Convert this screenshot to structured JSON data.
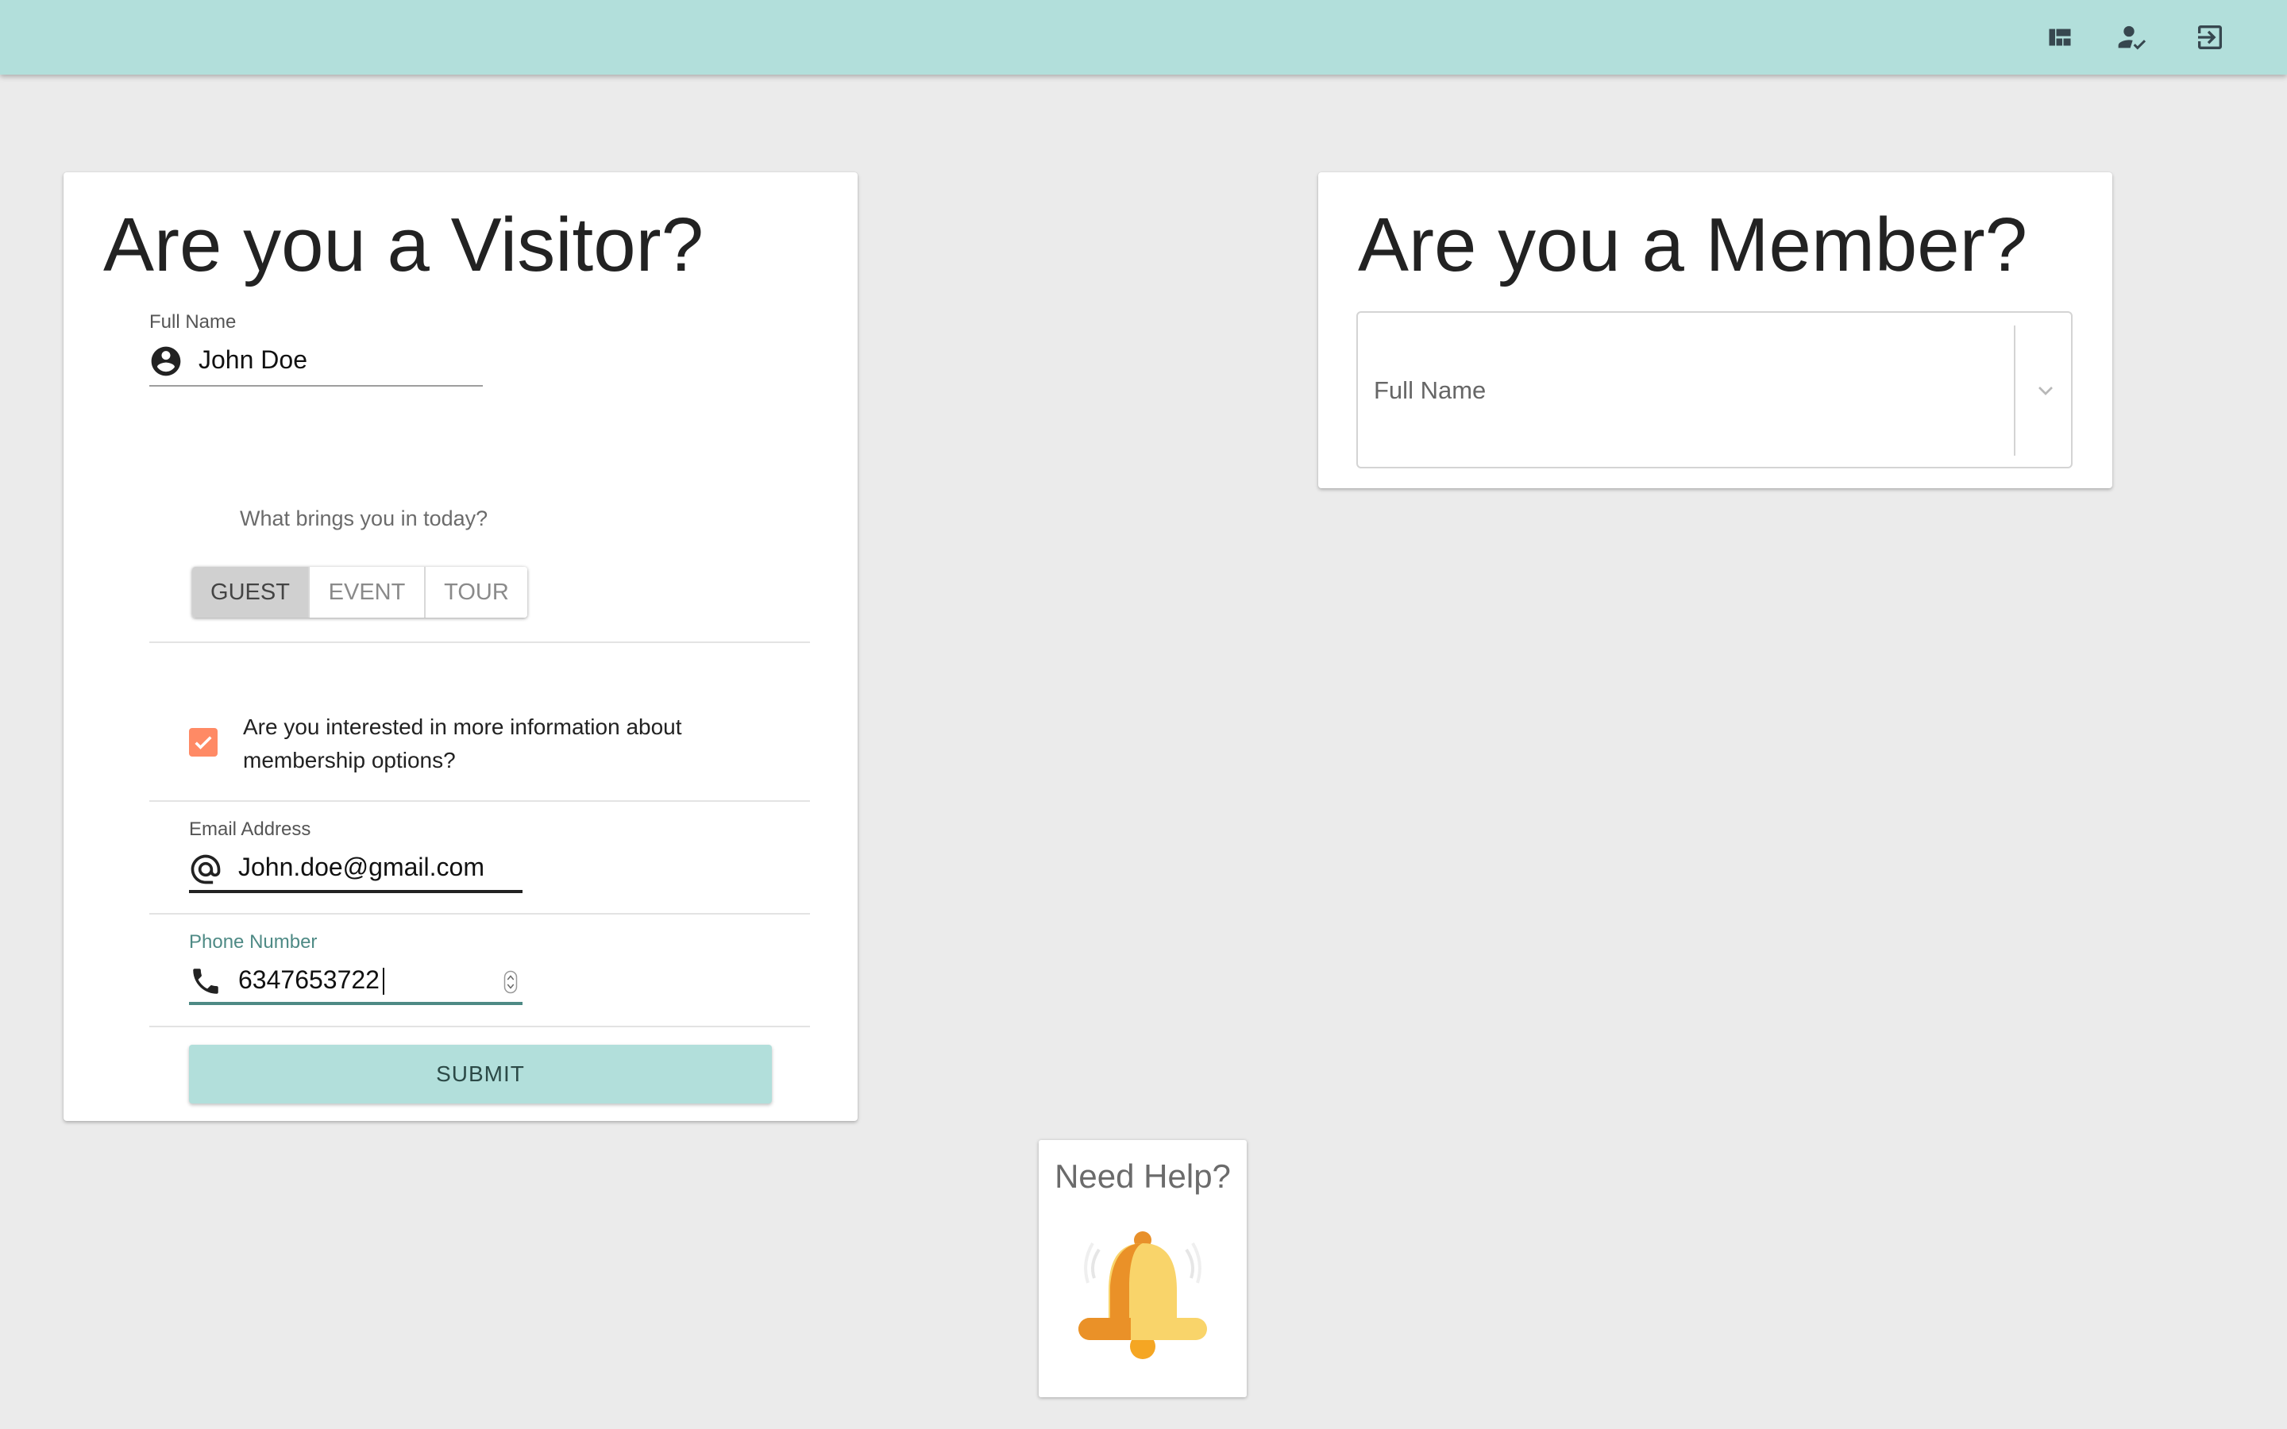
{
  "topbar": {
    "background": "#b2dfdb",
    "icons": [
      "dashboard-icon",
      "how-to-reg-icon",
      "exit-to-app-icon"
    ]
  },
  "visitor": {
    "title": "Are you a Visitor?",
    "full_name": {
      "label": "Full Name",
      "value": "John Doe",
      "icon": "account-circle-icon"
    },
    "purpose": {
      "prompt": "What brings you in today?",
      "options": [
        "GUEST",
        "EVENT",
        "TOUR"
      ],
      "selected": "GUEST"
    },
    "membership_info": {
      "checked": true,
      "label_line1": "Are you interested in more information about",
      "label_line2": "membership options?",
      "check_color": "#ff8a65"
    },
    "email": {
      "label": "Email Address",
      "value": "John.doe@gmail.com",
      "icon": "at-sign-icon"
    },
    "phone": {
      "label": "Phone Number",
      "value": "6347653722",
      "icon": "phone-icon",
      "focus_color": "#4e8a85"
    },
    "submit_label": "SUBMIT"
  },
  "member": {
    "title": "Are you a Member?",
    "select_placeholder": "Full Name",
    "icon": "chevron-down-icon"
  },
  "help": {
    "title": "Need Help?",
    "icon": "bell-icon"
  }
}
